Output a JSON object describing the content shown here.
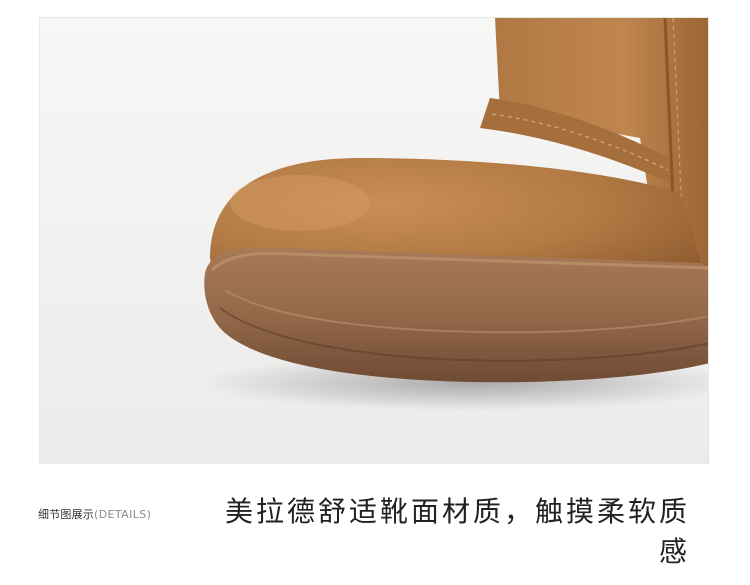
{
  "photo": {
    "subject": "boot-toe-detail",
    "colors": {
      "background": "#f4f4f3",
      "suede": "#b57c45",
      "suede_dark": "#8e5a2c",
      "sole": "#9a6d4c",
      "sole_dark": "#6e4a33",
      "stitch": "#d7a472"
    }
  },
  "caption": {
    "label_cn": "细节图展示",
    "label_en": "(DETAILS)"
  },
  "headline": {
    "text": "美拉德舒适靴面材质，触摸柔软质感"
  }
}
